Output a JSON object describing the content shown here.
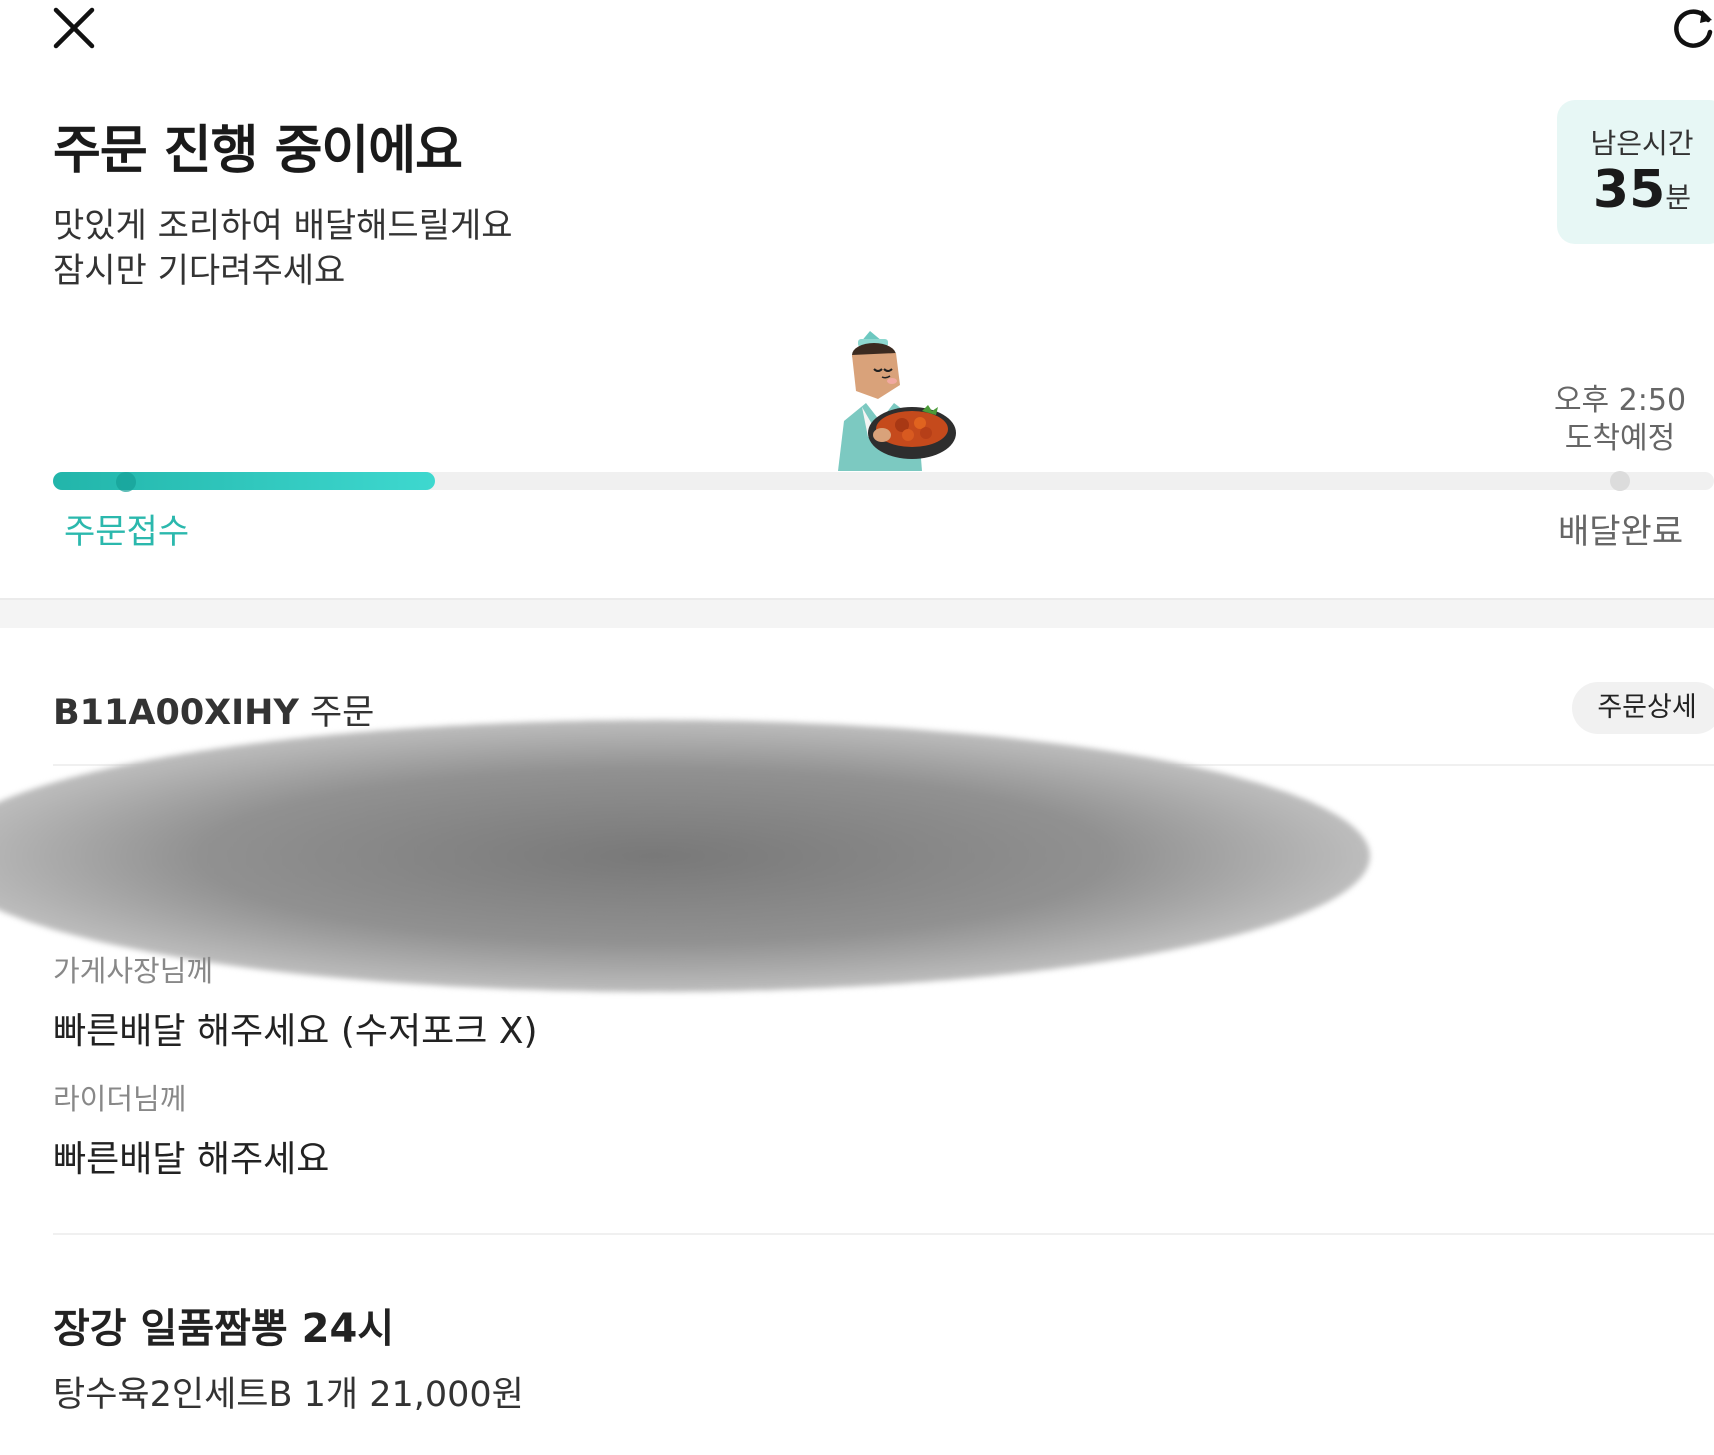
{
  "topbar": {
    "close_icon": "close-icon",
    "refresh_icon": "refresh-icon"
  },
  "header": {
    "title": "주문 진행 중이에요",
    "subtitle_line1": "맛있게 조리하여 배달해드릴게요",
    "subtitle_line2": "잠시만 기다려주세요"
  },
  "remaining": {
    "label": "남은시간",
    "value": "35",
    "unit": "분"
  },
  "progress": {
    "fraction": 0.23,
    "eta_time": "오후 2:50",
    "eta_label": "도착예정",
    "start_step": "주문접수",
    "end_step": "배달완료",
    "accent_color": "#2bb8ad"
  },
  "order": {
    "id": "B11A00XIHY",
    "suffix": "주문",
    "detail_button": "주문상세",
    "to_store_label": "가게사장님께",
    "to_store_message": "빠른배달 해주세요  (수저포크 X)",
    "to_rider_label": "라이더님께",
    "to_rider_message": "빠른배달 해주세요"
  },
  "store": {
    "name": "장강 일품짬뽕 24시",
    "item": "탕수육2인세트B 1개 21,000원"
  }
}
